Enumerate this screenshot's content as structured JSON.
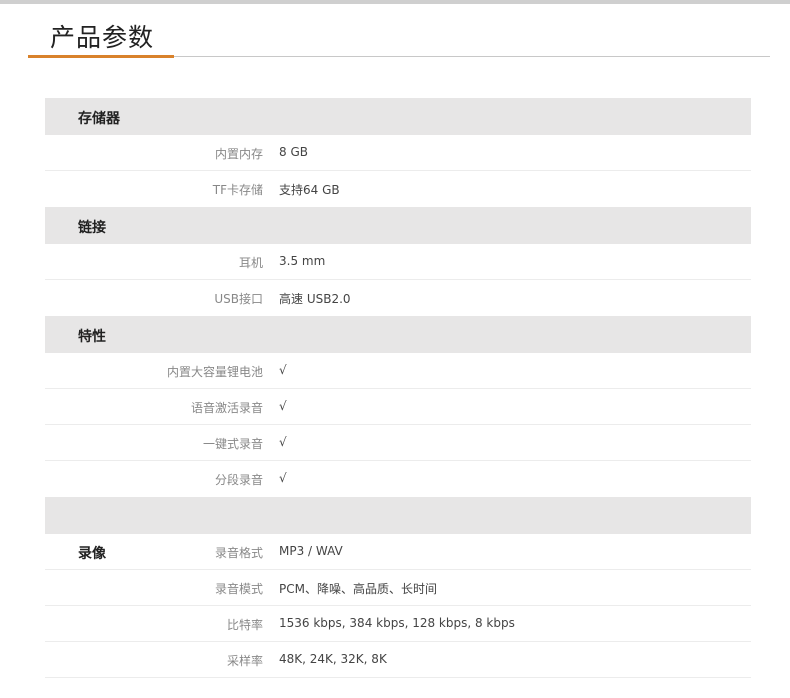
{
  "page": {
    "title": "产品参数"
  },
  "sections": [
    {
      "title": "存储器",
      "rows": [
        {
          "key": "内置内存",
          "value": "8 GB"
        },
        {
          "key": "TF卡存储",
          "value": "支持64 GB"
        }
      ]
    },
    {
      "title": "链接",
      "rows": [
        {
          "key": "耳机",
          "value": "3.5 mm"
        },
        {
          "key": "USB接口",
          "value": "高速 USB2.0"
        }
      ]
    },
    {
      "title": "特性",
      "rows": [
        {
          "key": "内置大容量锂电池",
          "value": "√"
        },
        {
          "key": "语音激活录音",
          "value": "√"
        },
        {
          "key": "一键式录音",
          "value": "√"
        },
        {
          "key": "分段录音",
          "value": "√"
        }
      ]
    },
    {
      "title": "",
      "row_label": "录像",
      "rows": [
        {
          "key": "录音格式",
          "value": "MP3 / WAV"
        },
        {
          "key": "录音模式",
          "value": "PCM、降噪、高品质、长时间"
        },
        {
          "key": "比特率",
          "value": "1536 kbps, 384 kbps, 128 kbps, 8 kbps"
        },
        {
          "key": "采样率",
          "value": "48K, 24K, 32K, 8K"
        }
      ]
    }
  ]
}
